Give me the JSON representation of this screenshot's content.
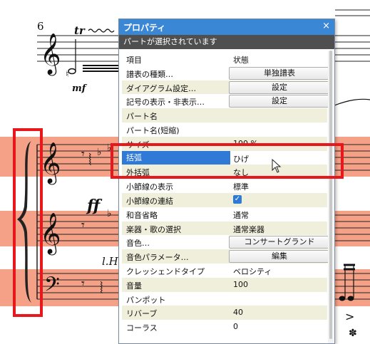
{
  "score": {
    "measure_number": "6",
    "trill_mark": "tr",
    "dynamic_mf": "mf",
    "dynamic_ff": "ff",
    "lh_mark": "l.H"
  },
  "panel": {
    "title": "プロパティ",
    "close_symbol": "×",
    "subtitle": "パートが選択されています",
    "header": {
      "item": "項目",
      "state": "状態"
    },
    "rows": [
      {
        "label": "譜表の種類…",
        "button": "単独譜表"
      },
      {
        "label": "ダイアグラム設定…",
        "button": "設定"
      },
      {
        "label": "記号の表示・非表示…",
        "button": "設定"
      },
      {
        "label": "パート名",
        "value": ""
      },
      {
        "label": "パート名(短縮)",
        "value": ""
      },
      {
        "label": "サイズ",
        "value": "100 %"
      },
      {
        "label": "括弧",
        "value": "ひげ"
      },
      {
        "label": "外括弧",
        "value": "なし"
      },
      {
        "label": "小節線の表示",
        "value": "標準"
      },
      {
        "label": "小節線の連結",
        "checked": true
      },
      {
        "label": "和音省略",
        "value": "通常"
      },
      {
        "label": "楽器・歌の選択",
        "value": "通常楽器"
      },
      {
        "label": "音色…",
        "button": "コンサートグランド"
      },
      {
        "label": "音色パラメータ…",
        "button": "編集"
      },
      {
        "label": "クレッシェンドタイプ",
        "value": "ベロシティ"
      },
      {
        "label": "音量",
        "value": "100"
      },
      {
        "label": "パンポット",
        "value": ""
      },
      {
        "label": "リバーブ",
        "value": "40"
      },
      {
        "label": "コーラス",
        "value": "0"
      }
    ]
  },
  "colors": {
    "titlebar": "#3a87d6",
    "staff_highlight": "#f5a187",
    "annotation_red": "#e8171c",
    "row_shade": "#f0efdc"
  }
}
